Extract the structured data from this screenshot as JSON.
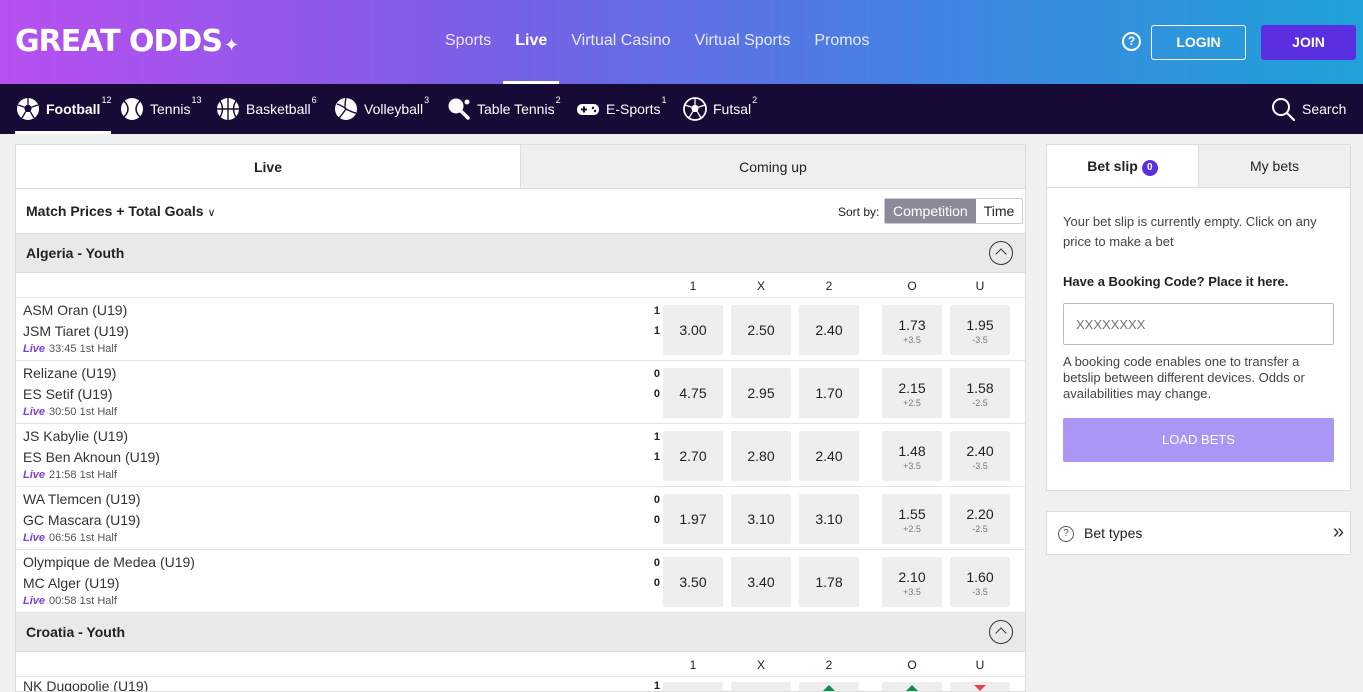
{
  "header": {
    "logo": "GREAT ODDS",
    "nav": [
      "Sports",
      "Live",
      "Virtual Casino",
      "Virtual Sports",
      "Promos"
    ],
    "help": "?",
    "login": "LOGIN",
    "join": "JOIN"
  },
  "sports": [
    {
      "label": "Football",
      "count": "12",
      "icon": "football-icon"
    },
    {
      "label": "Tennis",
      "count": "13",
      "icon": "tennis-icon"
    },
    {
      "label": "Basketball",
      "count": "6",
      "icon": "basketball-icon"
    },
    {
      "label": "Volleyball",
      "count": "3",
      "icon": "volleyball-icon"
    },
    {
      "label": "Table Tennis",
      "count": "2",
      "icon": "table-tennis-icon"
    },
    {
      "label": "E-Sports",
      "count": "1",
      "icon": "gamepad-icon"
    },
    {
      "label": "Futsal",
      "count": "2",
      "icon": "futsal-icon"
    }
  ],
  "search": "Search",
  "tabs": {
    "live": "Live",
    "coming": "Coming up"
  },
  "filter": {
    "market": "Match Prices + Total Goals",
    "sort_label": "Sort by:",
    "sort_competition": "Competition",
    "sort_time": "Time"
  },
  "columns": [
    "1",
    "X",
    "2",
    "O",
    "U"
  ],
  "competitions": [
    {
      "title": "Algeria - Youth",
      "matches": [
        {
          "home": "ASM Oran (U19)",
          "away": "JSM Tiaret (U19)",
          "hs": "1",
          "as": "1",
          "live": "Live",
          "time": "33:45 1st Half",
          "o1": "3.00",
          "ox": "2.50",
          "o2": "2.40",
          "oo": "1.73",
          "ol": "+3.5",
          "ou": "1.95",
          "ul": "-3.5"
        },
        {
          "home": "Relizane (U19)",
          "away": "ES Setif (U19)",
          "hs": "0",
          "as": "0",
          "live": "Live",
          "time": "30:50 1st Half",
          "o1": "4.75",
          "ox": "2.95",
          "o2": "1.70",
          "oo": "2.15",
          "ol": "+2.5",
          "ou": "1.58",
          "ul": "-2.5"
        },
        {
          "home": "JS Kabylie (U19)",
          "away": "ES Ben Aknoun (U19)",
          "hs": "1",
          "as": "1",
          "live": "Live",
          "time": "21:58 1st Half",
          "o1": "2.70",
          "ox": "2.80",
          "o2": "2.40",
          "oo": "1.48",
          "ol": "+3.5",
          "ou": "2.40",
          "ul": "-3.5"
        },
        {
          "home": "WA Tlemcen (U19)",
          "away": "GC Mascara (U19)",
          "hs": "0",
          "as": "0",
          "live": "Live",
          "time": "06:56 1st Half",
          "o1": "1.97",
          "ox": "3.10",
          "o2": "3.10",
          "oo": "1.55",
          "ol": "+2.5",
          "ou": "2.20",
          "ul": "-2.5"
        },
        {
          "home": "Olympique de Medea (U19)",
          "away": "MC Alger (U19)",
          "hs": "0",
          "as": "0",
          "live": "Live",
          "time": "00:58 1st Half",
          "o1": "3.50",
          "ox": "3.40",
          "o2": "1.78",
          "oo": "2.10",
          "ol": "+3.5",
          "ou": "1.60",
          "ul": "-3.5"
        }
      ]
    },
    {
      "title": "Croatia - Youth",
      "peek": {
        "home": "NK Dugopolje (U19)",
        "hs": "1"
      }
    }
  ],
  "betslip": {
    "tab": "Bet slip",
    "count": "0",
    "mybets": "My bets",
    "empty": "Your bet slip is currently empty. Click on any price to make a bet",
    "booking_header": "Have a Booking Code? Place it here.",
    "booking_placeholder": "XXXXXXXX",
    "booking_note": "A booking code enables one to transfer a betslip between different devices. Odds or availabilities may change.",
    "load": "LOAD BETS"
  },
  "bettypes": {
    "q": "?",
    "label": "Bet types",
    "chev": "»"
  },
  "colors": {
    "accent": "#5a2fe0",
    "live": "#7b3fe4",
    "up": "#0a8f4a",
    "down": "#e0434b"
  }
}
